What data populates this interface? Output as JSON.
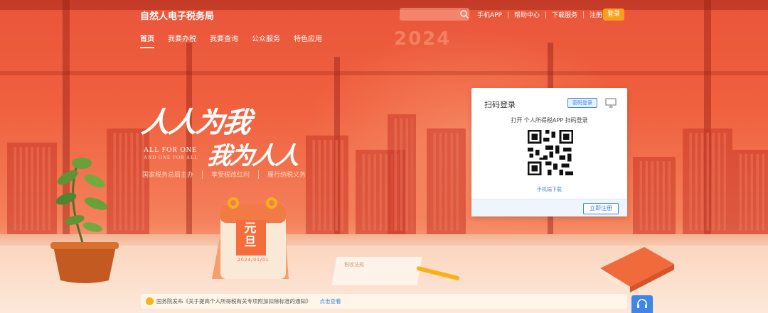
{
  "header": {
    "logo": "自然人电子税务局",
    "search": {
      "placeholder": "",
      "icon": "search-icon"
    },
    "links": [
      "手机APP",
      "帮助中心",
      "下载服务",
      "注册"
    ],
    "login": "登录"
  },
  "nav": {
    "tabs": [
      {
        "label": "首页",
        "active": true
      },
      {
        "label": "我要办税",
        "active": false
      },
      {
        "label": "我要查询",
        "active": false
      },
      {
        "label": "公众服务",
        "active": false
      },
      {
        "label": "特色应用",
        "active": false
      }
    ]
  },
  "hero": {
    "year": "2024",
    "slogan_line1": "人人为我",
    "slogan_line2": "我为人人",
    "english_line1": "ALL FOR ONE",
    "english_line2": "AND ONE FOR ALL",
    "sublines": [
      "国家税务总局主办",
      "享受税改红利",
      "履行纳税义务"
    ],
    "calendar_big": "元旦",
    "calendar_date": "2024/01/01",
    "paper_text": "税收法规"
  },
  "login_card": {
    "title": "扫码登录",
    "password_login": "密码登录",
    "hint": "打开 个人所得税APP 扫码登录",
    "download_link": "手机端下载",
    "register_button": "立即注册"
  },
  "notice": {
    "text": "国务院发布《关于提高个人所得税有关专项附加扣除标准的通知》",
    "link": "点击查看"
  },
  "colors": {
    "brand_orange": "#f0613f",
    "login_button": "#f7a11a",
    "accent_blue": "#3f86e8"
  }
}
